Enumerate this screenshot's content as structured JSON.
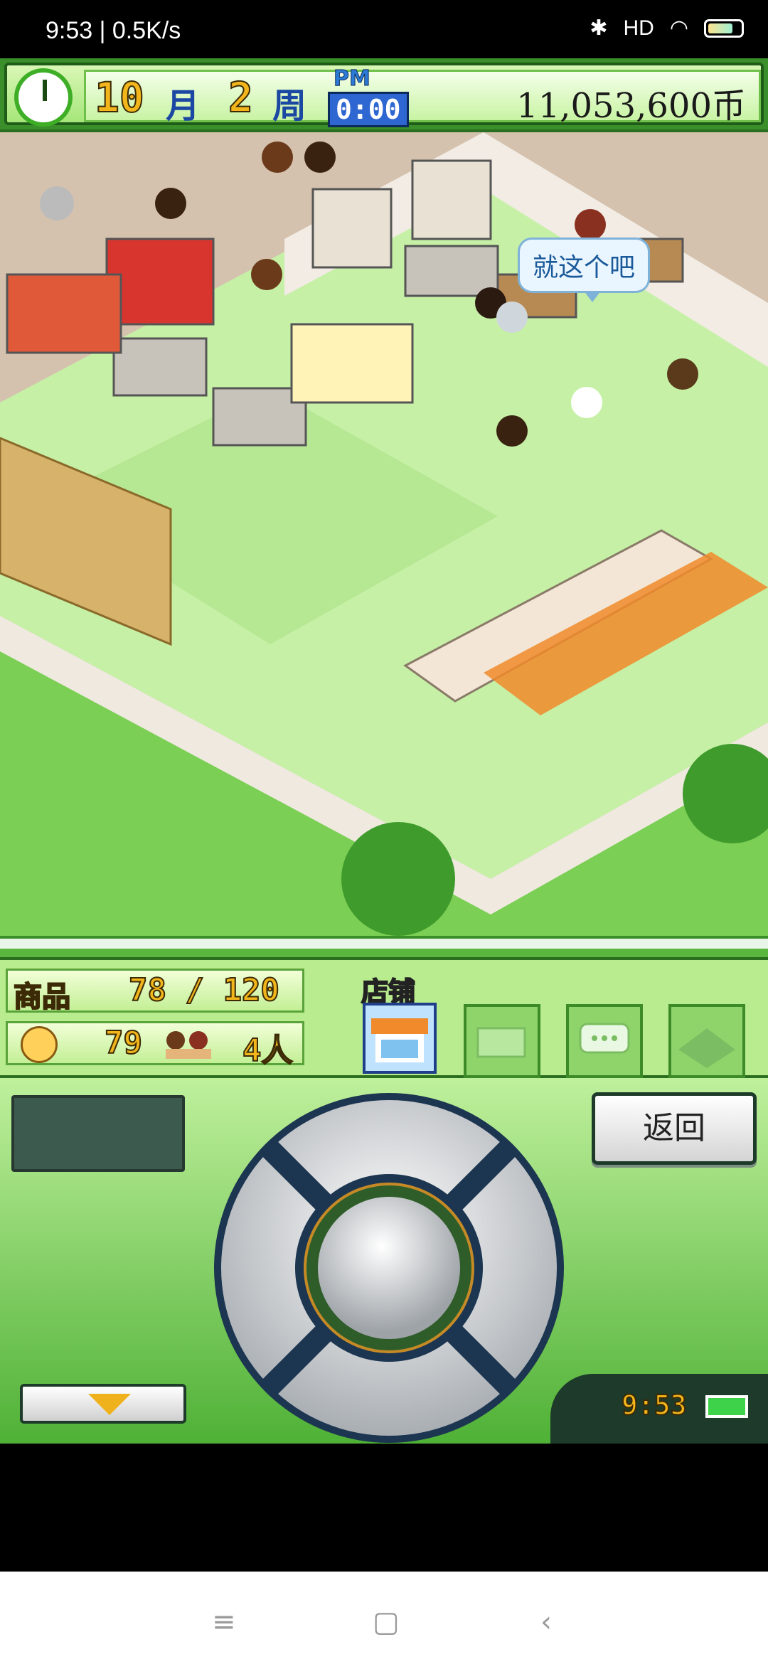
{
  "status_bar": {
    "time_speed": "9:53 | 0.5K/s",
    "icons": [
      "moon-icon",
      "alarm-icon",
      "sync-icon",
      "bluetooth-icon",
      "signal-icon",
      "wifi-icon",
      "battery-icon"
    ],
    "network": "HD"
  },
  "hud": {
    "month_num": "10",
    "month_label": "月",
    "week_num": "2",
    "week_label": "周",
    "period": "PM",
    "time": "0:00",
    "money": "11,053,600币"
  },
  "scene": {
    "speech_bubble": "就这个吧"
  },
  "stats": {
    "goods_label": "商品",
    "goods_value": "78 / 120",
    "popularity": "79",
    "customers": "4人"
  },
  "tabs": {
    "store_label": "店铺",
    "items": [
      "store-tab",
      "money-tab",
      "chat-tab",
      "map-tab"
    ]
  },
  "controls": {
    "back_label": "返回",
    "mini_time": "9:53"
  },
  "nav": {
    "menu": "≡",
    "home": "▢",
    "back": "‹"
  }
}
